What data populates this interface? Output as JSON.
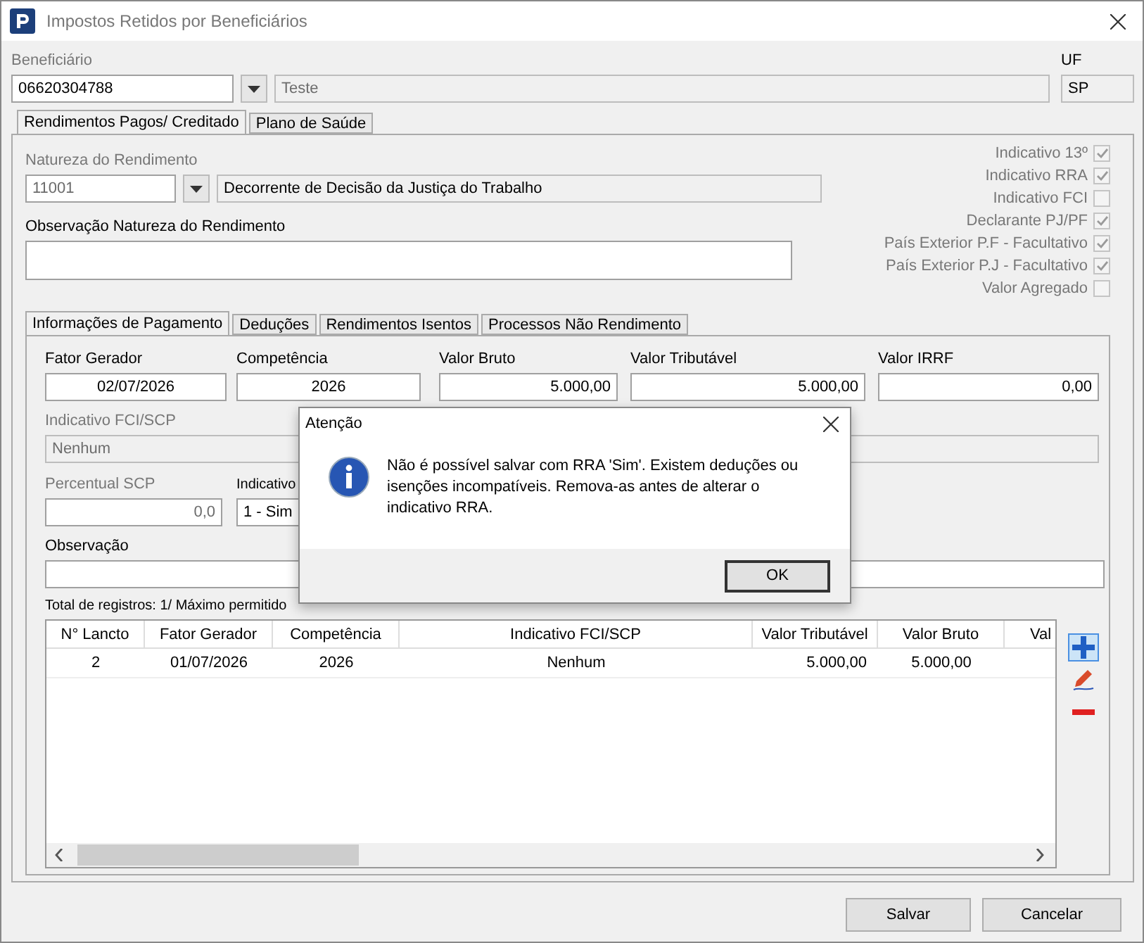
{
  "window": {
    "title": "Impostos Retidos por Beneficiários"
  },
  "beneficiario": {
    "label": "Beneficiário",
    "code": "06620304788",
    "name": "Teste",
    "name_disabled": true
  },
  "uf": {
    "label": "UF",
    "value": "SP"
  },
  "tabs": [
    {
      "label": "Rendimentos Pagos/ Creditado",
      "selected": true
    },
    {
      "label": "Plano de Saúde",
      "selected": false
    }
  ],
  "natureza": {
    "label": "Natureza do Rendimento",
    "code": "11001",
    "code_disabled": true,
    "description": "Decorrente de Decisão da Justiça do Trabalho"
  },
  "observacao_natureza": {
    "label": "Observação Natureza do Rendimento"
  },
  "flags": [
    {
      "label": "Indicativo 13º",
      "checked": true
    },
    {
      "label": "Indicativo RRA",
      "checked": true
    },
    {
      "label": "Indicativo FCI",
      "checked": false
    },
    {
      "label": "Declarante PJ/PF",
      "checked": true
    },
    {
      "label": "País Exterior P.F - Facultativo",
      "checked": true
    },
    {
      "label": "País Exterior P.J - Facultativo",
      "checked": true
    },
    {
      "label": "Valor Agregado",
      "checked": false
    }
  ],
  "inner_tabs": [
    {
      "label": "Informações de Pagamento",
      "selected": true
    },
    {
      "label": "Deduções",
      "selected": false
    },
    {
      "label": "Rendimentos Isentos",
      "selected": false
    },
    {
      "label": "Processos Não Rendimento",
      "selected": false
    }
  ],
  "payment_fields": [
    {
      "label": "Fator Gerador",
      "value": "02/07/2026"
    },
    {
      "label": "Competência",
      "value": "2026"
    },
    {
      "label": "Valor Bruto",
      "value": "5.000,00"
    },
    {
      "label": "Valor Tributável",
      "value": "5.000,00"
    },
    {
      "label": "Valor IRRF",
      "value": "0,00"
    }
  ],
  "indicativo_fci_scp": {
    "label": "Indicativo FCI/SCP",
    "value": "Nenhum",
    "disabled": true
  },
  "percentual_scp": {
    "label": "Percentual SCP",
    "value": "0,0",
    "disabled": true
  },
  "indicativo": {
    "label": "Indicativo",
    "value": "1 - Sim"
  },
  "observacao": {
    "label": "Observação"
  },
  "total_registros": "Total de registros: 1/ Máximo permitido",
  "table": {
    "columns": [
      "N° Lancto",
      "Fator Gerador",
      "Competência",
      "Indicativo FCI/SCP",
      "Valor Tributável",
      "Valor Bruto",
      "Val"
    ],
    "rows": [
      [
        "2",
        "01/07/2026",
        "2026",
        "Nenhum",
        "5.000,00",
        "5.000,00"
      ]
    ]
  },
  "buttons": [
    "Salvar",
    "Cancelar"
  ],
  "dialog": {
    "title": "Atenção",
    "message": "Não é possível salvar com RRA 'Sim'. Existem deduções ou isenções incompatíveis. Remova-as antes de alterar o indicativo RRA.",
    "button": "OK"
  }
}
